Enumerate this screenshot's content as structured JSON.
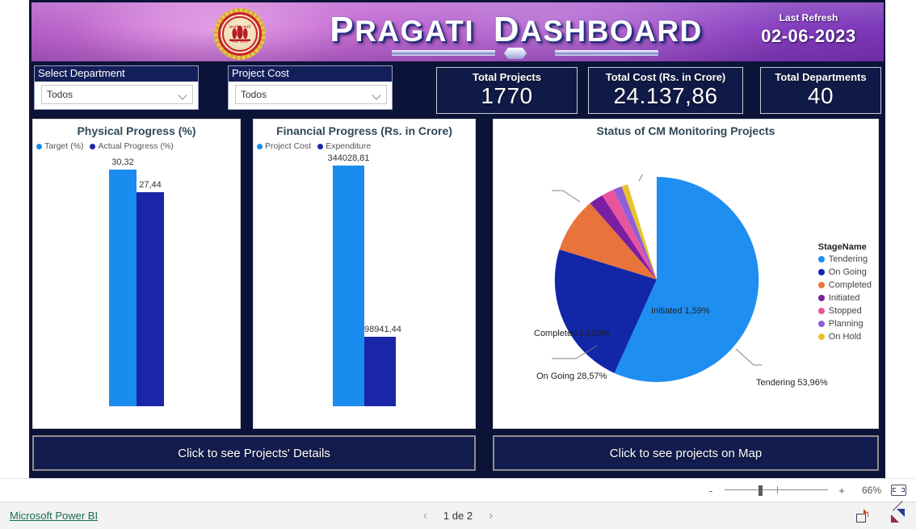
{
  "header": {
    "title_parts": [
      {
        "cap": "P",
        "rest": "RAGATI"
      },
      {
        "cap": "D",
        "rest": "ASHBOARD"
      }
    ],
    "title_plain": "Pragati Dashboard",
    "emblem_text_top": "सत्यमेव जयते",
    "emblem_text_bottom": "मध्य प्रदेश",
    "last_refresh_label": "Last Refresh",
    "last_refresh_date": "02-06-2023"
  },
  "slicers": [
    {
      "name": "department",
      "title": "Select Department",
      "value": "Todos",
      "icon": "chevron-down-icon"
    },
    {
      "name": "project_cost",
      "title": "Project Cost",
      "value": "Todos",
      "icon": "chevron-down-icon"
    }
  ],
  "kpis": [
    {
      "name": "total-projects",
      "label": "Total Projects",
      "value": "1770"
    },
    {
      "name": "total-cost",
      "label": "Total Cost (Rs. in Crore)",
      "value": "24.137,86"
    },
    {
      "name": "total-departments",
      "label": "Total Departments",
      "value": "40"
    }
  ],
  "buttons": {
    "details": "Click to see Projects' Details",
    "map": "Click to see projects on Map"
  },
  "statusbar": {
    "zoom_minus": "-",
    "zoom_plus": "+",
    "zoom_value": "66%",
    "fit_icon": "fit-to-page-icon"
  },
  "bottombar": {
    "brand_link": "Microsoft Power BI",
    "page_text": "1 de 2",
    "prev_icon": "‹",
    "next_icon": "›",
    "share_icon": "share-icon",
    "expand_icon": "fullscreen-icon"
  },
  "colors": {
    "target_blue": "#1a8cf0",
    "actual_navy": "#1a25a8",
    "tendering": "#1f8ef1",
    "on_going": "#1226a8",
    "completed": "#e8743b",
    "initiated": "#7b1fa2",
    "stopped": "#e8559e",
    "planning": "#8e5fd8",
    "on_hold": "#e8c22a",
    "canvas_navy": "#0c1338",
    "card_navy": "#101a46"
  },
  "chart_data": [
    {
      "type": "bar",
      "name": "physical-progress",
      "title": "Physical Progress (%)",
      "categories": [
        "Target (%)",
        "Actual Progress (%)"
      ],
      "values": [
        30.32,
        27.44
      ],
      "value_labels": [
        "30,32",
        "27,44"
      ],
      "legend": [
        {
          "label": "Target (%)",
          "color": "#1a8cf0"
        },
        {
          "label": "Actual Progress (%)",
          "color": "#1a25a8"
        }
      ],
      "legend_position": "top-left",
      "ylabel": "",
      "xlabel": "",
      "grid": false,
      "ylim": [
        0,
        33
      ]
    },
    {
      "type": "bar",
      "name": "financial-progress",
      "title": "Financial Progress (Rs. in Crore)",
      "categories": [
        "Project Cost",
        "Expenditure"
      ],
      "values": [
        344028.81,
        98941.44
      ],
      "value_labels": [
        "344028,81",
        "98941,44"
      ],
      "legend": [
        {
          "label": "Project Cost",
          "color": "#1a8cf0"
        },
        {
          "label": "Expenditure",
          "color": "#1a25a8"
        }
      ],
      "legend_position": "top-left",
      "ylabel": "",
      "xlabel": "",
      "grid": false,
      "ylim": [
        0,
        370000
      ]
    },
    {
      "type": "pie",
      "name": "status-cm-monitoring",
      "title": "Status of CM Monitoring Projects",
      "legend_title": "StageName",
      "legend_position": "right",
      "slices": [
        {
          "label": "Tendering",
          "percent": 53.96,
          "percent_label": "Tendering 53,96%",
          "color": "#1f8ef1",
          "callout": true
        },
        {
          "label": "On Going",
          "percent": 28.57,
          "percent_label": "On Going 28,57%",
          "color": "#1226a8",
          "callout": true
        },
        {
          "label": "Completed",
          "percent": 13.03,
          "percent_label": "Completed 13,03%",
          "color": "#e8743b",
          "callout": true
        },
        {
          "label": "Initiated",
          "percent": 1.59,
          "percent_label": "Initiated 1,59%",
          "color": "#7b1fa2",
          "callout": true
        },
        {
          "label": "Stopped",
          "percent": 1.3,
          "percent_label": "",
          "color": "#e8559e",
          "callout": false
        },
        {
          "label": "Planning",
          "percent": 0.9,
          "percent_label": "",
          "color": "#8e5fd8",
          "callout": false
        },
        {
          "label": "On Hold",
          "percent": 0.65,
          "percent_label": "",
          "color": "#e8c22a",
          "callout": false
        }
      ]
    }
  ]
}
